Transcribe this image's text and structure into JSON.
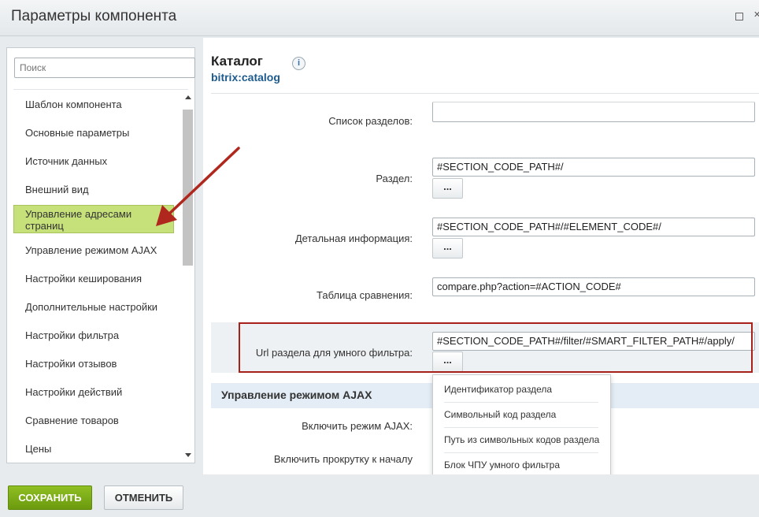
{
  "window": {
    "title": "Параметры компонента"
  },
  "search": {
    "placeholder": "Поиск"
  },
  "sidebar": {
    "items": [
      {
        "label": "Шаблон компонента"
      },
      {
        "label": "Основные параметры"
      },
      {
        "label": "Источник данных"
      },
      {
        "label": "Внешний вид"
      },
      {
        "label": "Управление адресами страниц"
      },
      {
        "label": "Управление режимом AJAX"
      },
      {
        "label": "Настройки кеширования"
      },
      {
        "label": "Дополнительные настройки"
      },
      {
        "label": "Настройки фильтра"
      },
      {
        "label": "Настройки отзывов"
      },
      {
        "label": "Настройки действий"
      },
      {
        "label": "Сравнение товаров"
      },
      {
        "label": "Цены"
      }
    ]
  },
  "component": {
    "title": "Каталог",
    "code": "bitrix:catalog",
    "info_icon": "i"
  },
  "fields": [
    {
      "label": "Список разделов:",
      "value": ""
    },
    {
      "label": "Раздел:",
      "value": "#SECTION_CODE_PATH#/"
    },
    {
      "label": "Детальная информация:",
      "value": "#SECTION_CODE_PATH#/#ELEMENT_CODE#/"
    },
    {
      "label": "Таблица сравнения:",
      "value": "compare.php?action=#ACTION_CODE#"
    },
    {
      "label": "Url раздела для умного фильтра:",
      "value": "#SECTION_CODE_PATH#/filter/#SMART_FILTER_PATH#/apply/"
    }
  ],
  "dots_label": "...",
  "section_ajax": {
    "title": "Управление режимом AJAX",
    "rows": [
      {
        "label": "Включить режим AJAX:"
      },
      {
        "label": "Включить прокрутку к началу"
      }
    ]
  },
  "dropdown": {
    "items": [
      {
        "label": "Идентификатор раздела"
      },
      {
        "label": "Символьный код раздела"
      },
      {
        "label": "Путь из символьных кодов раздела"
      },
      {
        "label": "Блок ЧПУ умного фильтра"
      }
    ]
  },
  "footer": {
    "save_label": "СОХРАНИТЬ",
    "cancel_label": "ОТМЕНИТЬ"
  },
  "colors": {
    "accent_green": "#79a918",
    "active_item": "#c6e07a",
    "annotation_red": "#a8201a",
    "link_blue": "#1d5b8e"
  }
}
